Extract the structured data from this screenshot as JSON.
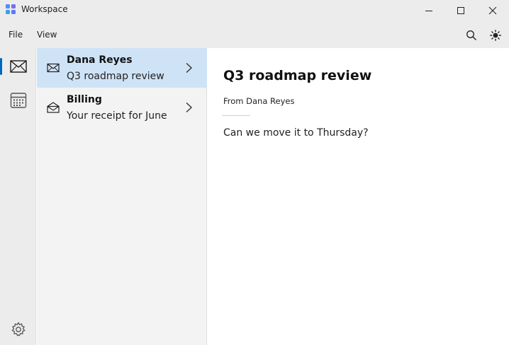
{
  "window": {
    "title": "Workspace",
    "controls": {
      "minimize": "minimize-icon",
      "maximize": "maximize-icon",
      "close": "close-icon"
    }
  },
  "menu": {
    "items": [
      {
        "label": "File"
      },
      {
        "label": "View"
      }
    ]
  },
  "toolbar": {
    "search_icon": "search-icon",
    "theme_icon": "sun-icon"
  },
  "rail": {
    "items": [
      {
        "icon": "mail-icon",
        "active": true
      },
      {
        "icon": "calendar-icon",
        "active": false
      }
    ],
    "settings_icon": "gear-icon"
  },
  "messages": [
    {
      "sender": "Dana Reyes",
      "subject": "Q3 roadmap review",
      "selected": true,
      "icon": "envelope-icon"
    },
    {
      "sender": "Billing",
      "subject": "Your receipt for June",
      "selected": false,
      "icon": "envelope-open-icon"
    }
  ],
  "reading_pane": {
    "subject": "Q3 roadmap review",
    "from": "From Dana Reyes",
    "body": "Can we move it to Thursday?"
  },
  "colors": {
    "accent": "#0067c0",
    "selected_row": "#cfe3f7",
    "chrome": "#ececec"
  }
}
